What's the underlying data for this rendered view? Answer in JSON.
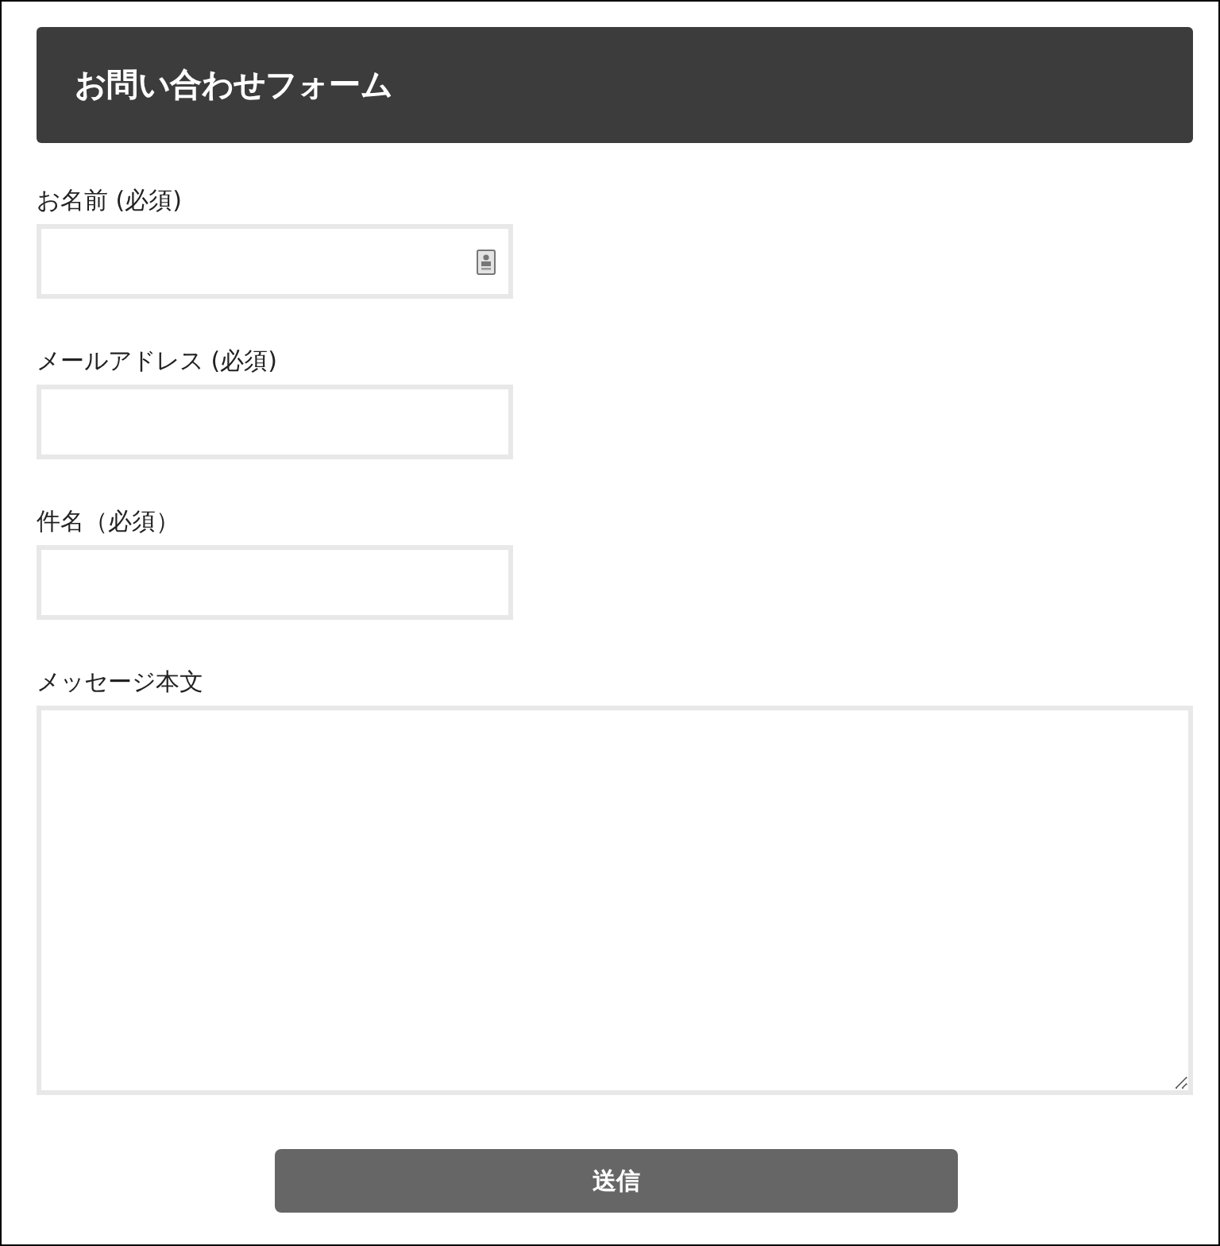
{
  "header": {
    "title": "お問い合わせフォーム"
  },
  "fields": [
    {
      "kind": "contact",
      "label": "お名前 (必須)"
    },
    {
      "kind": "input",
      "label": "メールアドレス (必須)"
    },
    {
      "kind": "input",
      "label": "件名（必須）"
    },
    {
      "kind": "textarea",
      "label": "メッセージ本文"
    }
  ],
  "submit": {
    "label": "送信"
  }
}
